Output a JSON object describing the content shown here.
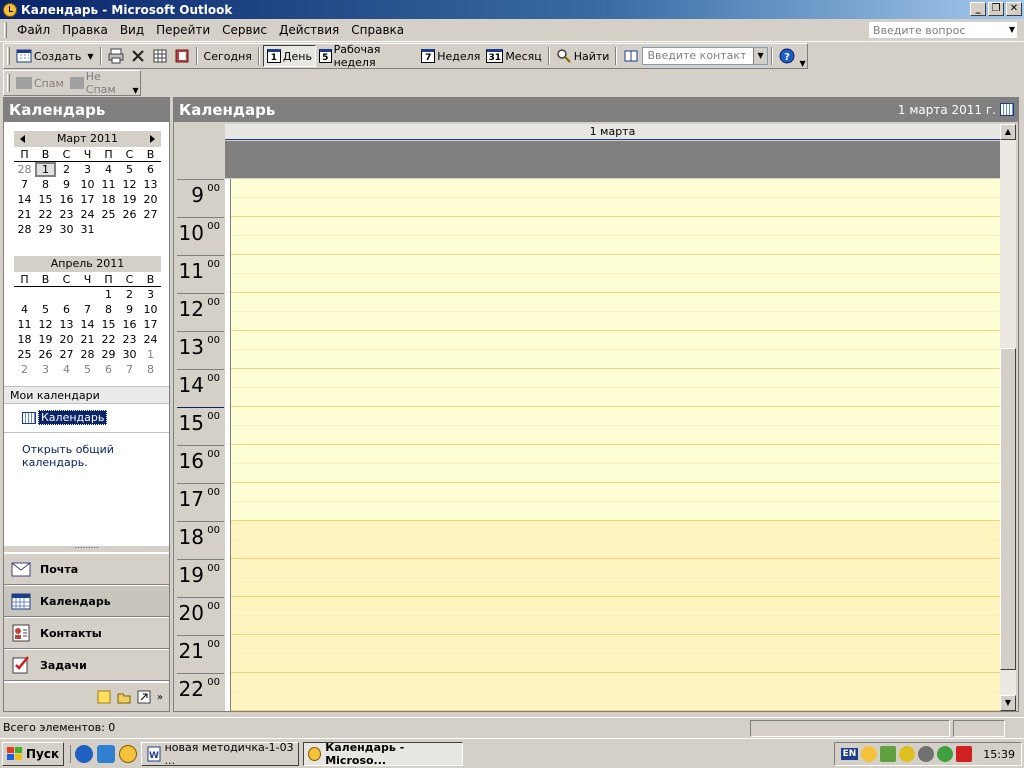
{
  "window": {
    "title": "Календарь - Microsoft Outlook",
    "min_glyph": "_",
    "max_glyph": "❐",
    "close_glyph": "✕"
  },
  "menubar": {
    "items": [
      "Файл",
      "Правка",
      "Вид",
      "Перейти",
      "Сервис",
      "Действия",
      "Справка"
    ],
    "ask_placeholder": "Введите вопрос"
  },
  "toolbar": {
    "new_label": "Создать",
    "today_label": "Сегодня",
    "day_label": "День",
    "day_num": "1",
    "workweek_label": "Рабочая неделя",
    "workweek_num": "5",
    "week_label": "Неделя",
    "week_num": "7",
    "month_label": "Месяц",
    "month_num": "31",
    "find_label": "Найти",
    "contact_placeholder": "Введите контакт"
  },
  "spam_toolbar": {
    "spam_label": "Спам",
    "notspam_label": "Не Спам"
  },
  "nav": {
    "header": "Календарь",
    "month1": {
      "title": "Март 2011",
      "dow": [
        "П",
        "В",
        "С",
        "Ч",
        "П",
        "С",
        "В"
      ],
      "days": [
        {
          "d": "28",
          "o": true
        },
        {
          "d": "1",
          "t": true
        },
        {
          "d": "2"
        },
        {
          "d": "3"
        },
        {
          "d": "4"
        },
        {
          "d": "5"
        },
        {
          "d": "6"
        },
        {
          "d": "7"
        },
        {
          "d": "8"
        },
        {
          "d": "9"
        },
        {
          "d": "10"
        },
        {
          "d": "11"
        },
        {
          "d": "12"
        },
        {
          "d": "13"
        },
        {
          "d": "14"
        },
        {
          "d": "15"
        },
        {
          "d": "16"
        },
        {
          "d": "17"
        },
        {
          "d": "18"
        },
        {
          "d": "19"
        },
        {
          "d": "20"
        },
        {
          "d": "21"
        },
        {
          "d": "22"
        },
        {
          "d": "23"
        },
        {
          "d": "24"
        },
        {
          "d": "25"
        },
        {
          "d": "26"
        },
        {
          "d": "27"
        },
        {
          "d": "28"
        },
        {
          "d": "29"
        },
        {
          "d": "30"
        },
        {
          "d": "31"
        },
        {
          "d": ""
        },
        {
          "d": ""
        },
        {
          "d": ""
        }
      ]
    },
    "month2": {
      "title": "Апрель 2011",
      "dow": [
        "П",
        "В",
        "С",
        "Ч",
        "П",
        "С",
        "В"
      ],
      "days": [
        {
          "d": ""
        },
        {
          "d": ""
        },
        {
          "d": ""
        },
        {
          "d": ""
        },
        {
          "d": "1"
        },
        {
          "d": "2"
        },
        {
          "d": "3"
        },
        {
          "d": "4"
        },
        {
          "d": "5"
        },
        {
          "d": "6"
        },
        {
          "d": "7"
        },
        {
          "d": "8"
        },
        {
          "d": "9"
        },
        {
          "d": "10"
        },
        {
          "d": "11"
        },
        {
          "d": "12"
        },
        {
          "d": "13"
        },
        {
          "d": "14"
        },
        {
          "d": "15"
        },
        {
          "d": "16"
        },
        {
          "d": "17"
        },
        {
          "d": "18"
        },
        {
          "d": "19"
        },
        {
          "d": "20"
        },
        {
          "d": "21"
        },
        {
          "d": "22"
        },
        {
          "d": "23"
        },
        {
          "d": "24"
        },
        {
          "d": "25"
        },
        {
          "d": "26"
        },
        {
          "d": "27"
        },
        {
          "d": "28"
        },
        {
          "d": "29"
        },
        {
          "d": "30"
        },
        {
          "d": "1",
          "o": true
        },
        {
          "d": "2",
          "o": true
        },
        {
          "d": "3",
          "o": true
        },
        {
          "d": "4",
          "o": true
        },
        {
          "d": "5",
          "o": true
        },
        {
          "d": "6",
          "o": true
        },
        {
          "d": "7",
          "o": true
        },
        {
          "d": "8",
          "o": true
        }
      ]
    },
    "my_calendars": "Мои календари",
    "calendar_entry": "Календарь",
    "open_shared": "Открыть общий календарь.",
    "buttons": {
      "mail": "Почта",
      "calendar": "Календарь",
      "contacts": "Контакты",
      "tasks": "Задачи"
    }
  },
  "main": {
    "header": "Календарь",
    "date": "1 марта 2011 г.",
    "day_column": "1 марта",
    "hours": [
      "9",
      "10",
      "11",
      "12",
      "13",
      "14",
      "15",
      "16",
      "17",
      "18",
      "19",
      "20",
      "21",
      "22"
    ],
    "minutes": "00",
    "current_hour": "15"
  },
  "status": {
    "items": "Всего элементов: 0"
  },
  "taskbar": {
    "start": "Пуск",
    "task1": "новая методичка-1-03 ...",
    "task2": "Календарь - Microso...",
    "lang": "EN",
    "clock": "15:39"
  },
  "colors": {
    "work_hours": "#ffffd5",
    "off_hours": "#fff4c0",
    "header_gray": "#808080",
    "title_blue": "#0a246a"
  }
}
